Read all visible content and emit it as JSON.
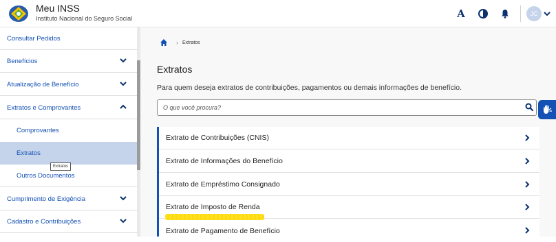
{
  "header": {
    "app_title": "Meu INSS",
    "app_subtitle": "Instituto Nacional do Seguro Social",
    "font_size_label": "A",
    "contrast_icon": "contrast-icon",
    "bell_icon": "bell-icon",
    "avatar_initials": "JC",
    "brand_color": "#1351b4",
    "dark_blue": "#0c326f"
  },
  "sidebar": {
    "items": [
      {
        "label": "Consultar Pedidos"
      },
      {
        "label": "Benefícios"
      },
      {
        "label": "Atualização de Benefício"
      },
      {
        "label": "Extratos e Comprovantes"
      },
      {
        "label": "Comprovantes"
      },
      {
        "label": "Extratos"
      },
      {
        "label": "Outros Documentos"
      },
      {
        "label": "Cumprimento de Exigência"
      },
      {
        "label": "Cadastro e Contribuições"
      }
    ],
    "tooltip": "Extratos",
    "active_bg": "#c5d4eb"
  },
  "breadcrumb": {
    "current": "Extratos"
  },
  "main": {
    "title": "Extratos",
    "description": "Para quem deseja extratos de contribuições, pagamentos ou demais informações de benefício.",
    "search_placeholder": "O que você procura?",
    "items": [
      {
        "label": "Extrato de Contribuições (CNIS)"
      },
      {
        "label": "Extrato de Informações do Benefício"
      },
      {
        "label": "Extrato de Empréstimo Consignado"
      },
      {
        "label": "Extrato de Imposto de Renda"
      },
      {
        "label": "Extrato de Pagamento de Benefício"
      }
    ]
  }
}
